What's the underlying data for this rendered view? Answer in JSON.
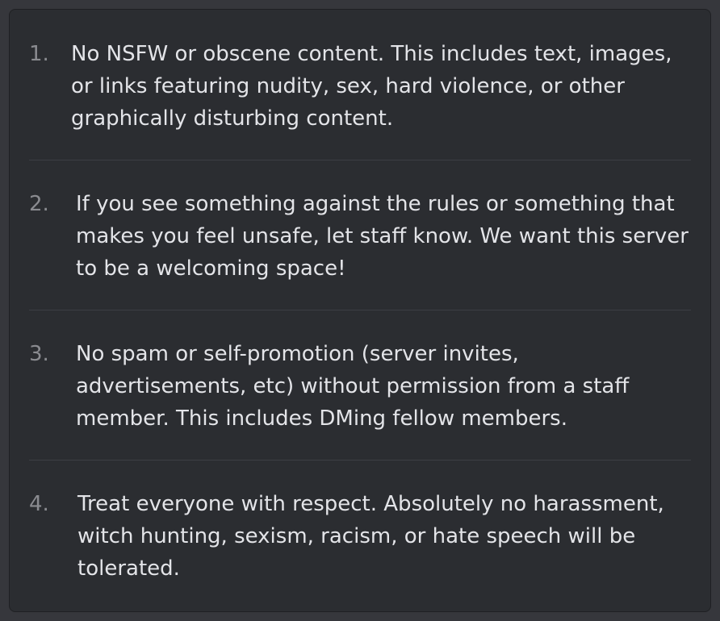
{
  "rules": [
    {
      "number": "1.",
      "text": "No NSFW or obscene content. This includes text, images, or links featuring nudity, sex, hard violence, or other graphically disturbing content."
    },
    {
      "number": "2.",
      "text": "If you see something against the rules or something that makes you feel unsafe, let staff know. We want this server to be a welcoming space!"
    },
    {
      "number": "3.",
      "text": "No spam or self-promotion (server invites, advertisements, etc) without permission from a staff member. This includes DMing fellow members."
    },
    {
      "number": "4.",
      "text": "Treat everyone with respect. Absolutely no harassment, witch hunting, sexism, racism, or hate speech will be tolerated."
    }
  ]
}
